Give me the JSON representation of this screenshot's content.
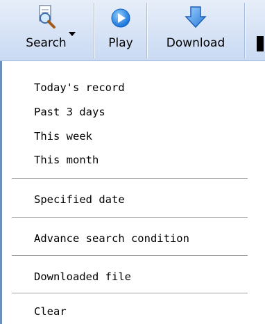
{
  "toolbar": {
    "buttons": [
      {
        "label": "Search",
        "icon": "magnifier-doc-icon",
        "has_dropdown": true
      },
      {
        "label": "Play",
        "icon": "play-icon"
      },
      {
        "label": "Download",
        "icon": "download-arrow-icon"
      }
    ]
  },
  "menu": {
    "items": [
      {
        "label": "Today's record"
      },
      {
        "label": "Past 3 days"
      },
      {
        "label": "This week"
      },
      {
        "label": "This month"
      },
      {
        "label": "Specified date"
      },
      {
        "label": "Advance search condition"
      },
      {
        "label": "Downloaded file"
      },
      {
        "label": "Clear"
      }
    ]
  }
}
